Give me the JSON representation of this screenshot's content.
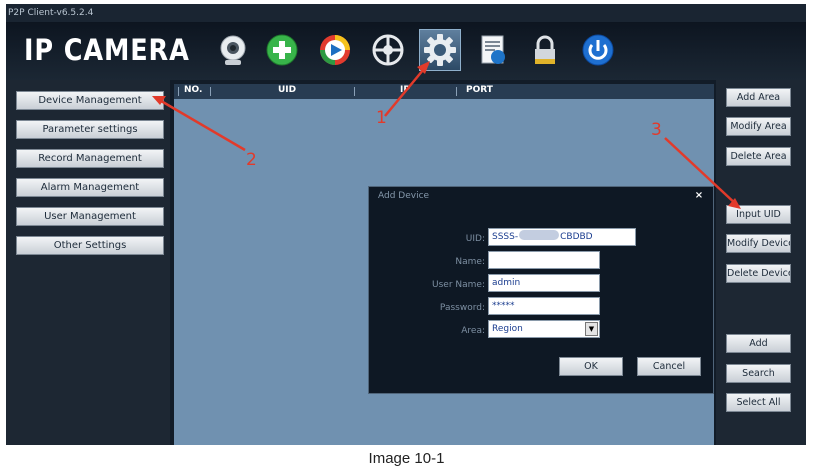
{
  "window": {
    "title": "P2P Client-v6.5.2.4"
  },
  "header": {
    "logo": "IP CAMERA",
    "toolbar": [
      {
        "name": "camera-icon",
        "selected": false
      },
      {
        "name": "add-icon",
        "selected": false
      },
      {
        "name": "playback-icon",
        "selected": false
      },
      {
        "name": "ptz-control-icon",
        "selected": false
      },
      {
        "name": "settings-gear-icon",
        "selected": true
      },
      {
        "name": "log-document-icon",
        "selected": false
      },
      {
        "name": "lock-icon",
        "selected": false
      },
      {
        "name": "power-icon",
        "selected": false
      }
    ]
  },
  "sidebar": {
    "items": [
      {
        "label": "Device Management"
      },
      {
        "label": "Parameter settings"
      },
      {
        "label": "Record Management"
      },
      {
        "label": "Alarm Management"
      },
      {
        "label": "User Management"
      },
      {
        "label": "Other Settings"
      }
    ]
  },
  "table": {
    "columns": [
      "NO.",
      "UID",
      "IP",
      "PORT"
    ]
  },
  "rightbar": {
    "buttons": [
      {
        "label": "Add Area"
      },
      {
        "label": "Modify Area"
      },
      {
        "label": "Delete Area"
      },
      {
        "label": "Input UID"
      },
      {
        "label": "Modify Device"
      },
      {
        "label": "Delete Device"
      },
      {
        "label": "Add"
      },
      {
        "label": "Search"
      },
      {
        "label": "Select All"
      }
    ]
  },
  "dialog": {
    "title": "Add Device",
    "close": "×",
    "uid_label": "UID:",
    "uid_prefix": "SSSS-",
    "uid_suffix": "CBDBD",
    "name_label": "Name:",
    "name_value": "",
    "username_label": "User Name:",
    "username_value": "admin",
    "password_label": "Password:",
    "password_value": "*****",
    "area_label": "Area:",
    "area_value": "Region",
    "ok_label": "OK",
    "cancel_label": "Cancel"
  },
  "annotations": [
    "1",
    "2",
    "3"
  ],
  "caption": "Image 10-1",
  "colors": {
    "annotation_red": "#e23a2a",
    "main_panel": "#7091b0",
    "dark_bg": "#121c28"
  }
}
